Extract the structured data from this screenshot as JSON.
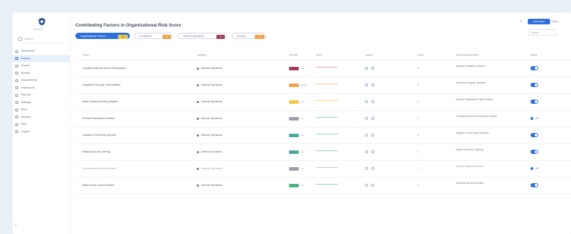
{
  "app": {
    "logo_text": "RISKAPP",
    "search_placeholder": "Search"
  },
  "sidebar": {
    "items": [
      {
        "label": "Dashboard",
        "active": false,
        "chevron": false
      },
      {
        "label": "Factors",
        "active": true,
        "chevron": false
      },
      {
        "label": "Scores",
        "active": false,
        "chevron": false
      },
      {
        "label": "Models",
        "active": false,
        "chevron": false
      },
      {
        "label": "Departments",
        "active": false,
        "chevron": false
      },
      {
        "label": "Employees",
        "active": false,
        "chevron": true
      },
      {
        "label": "Reports",
        "active": false,
        "chevron": false
      },
      {
        "label": "Settings",
        "active": false,
        "chevron": true
      },
      {
        "label": "More",
        "active": false,
        "chevron": true
      },
      {
        "label": "Security",
        "active": false,
        "chevron": false
      },
      {
        "label": "Help",
        "active": false,
        "chevron": true
      },
      {
        "label": "Logout",
        "active": false,
        "chevron": false
      }
    ]
  },
  "header": {
    "title": "Contributing Factors in Organizational Risk Score",
    "close": "×",
    "primary_button": "Add Factor",
    "secondary_button": "Export",
    "search_placeholder": "Search"
  },
  "tabs": [
    {
      "label": "Organizational Factors",
      "count": "12"
    },
    {
      "label": "Compliance",
      "count": "4"
    },
    {
      "label": "Internal Operations",
      "count": "3"
    },
    {
      "label": "Security",
      "count": "6"
    }
  ],
  "table": {
    "headers": [
      "Factor",
      "Category",
      "Severity",
      "Trend",
      "Actions",
      "Count",
      "Recommended Action",
      "Status"
    ],
    "rows": [
      {
        "factor": "Outdated Software Across Workspaces",
        "category": "Internal Operations",
        "severity_color": "#a33b5e",
        "severity_label": "High",
        "trend_color": "#f2a3b0",
        "count": "8",
        "rec": "Update Outdated Software",
        "enabled": true,
        "muted": false,
        "toggle_label": ""
      },
      {
        "factor": "Unpatched Security Vulnerabilities",
        "category": "Internal Operations",
        "severity_color": "#f0a24a",
        "severity_label": "Medium",
        "trend_color": "#f5c48a",
        "count": "5",
        "rec": "Schedule Regular Updates",
        "enabled": true,
        "muted": false,
        "toggle_label": ""
      },
      {
        "factor": "Weak Password Policy Adoption",
        "category": "Internal Operations",
        "severity_color": "#f2c94c",
        "severity_label": "Low",
        "trend_color": "#f5d97a",
        "count": "3",
        "rec": "Require Password Policy Review",
        "enabled": true,
        "muted": false,
        "toggle_label": ""
      },
      {
        "factor": "Excess Permissions Granted",
        "category": "Internal Operations",
        "severity_color": "#9a9fa8",
        "severity_label": "Low",
        "trend_color": "#8fd3c4",
        "count": "2",
        "rec": "Conduct Access Permissions Review",
        "enabled": false,
        "muted": false,
        "toggle_label": "Off"
      },
      {
        "factor": "Outdated Third-Party Libraries",
        "category": "Internal Operations",
        "severity_color": "#4aa79a",
        "severity_label": "Low",
        "trend_color": "#8fd3c4",
        "count": "2",
        "rec": "Upgrade Third-Party Libraries",
        "enabled": true,
        "muted": false,
        "toggle_label": ""
      },
      {
        "factor": "Missing Security Training",
        "category": "Internal Operations",
        "severity_color": "#4aa79a",
        "severity_label": "Low",
        "trend_color": "#8fd3c4",
        "count": "1",
        "rec": "Deliver Security Training",
        "enabled": true,
        "muted": false,
        "toggle_label": ""
      },
      {
        "factor": "Unmonitored Network Devices",
        "category": "Internal Operations",
        "severity_color": "#9a9fa8",
        "severity_label": "Low",
        "trend_color": "#c4cbd6",
        "count": "1",
        "rec": "Monitor Network Devices",
        "enabled": false,
        "muted": true,
        "toggle_label": "Off"
      },
      {
        "factor": "Stale Access Control Entries",
        "category": "Internal Operations",
        "severity_color": "#4caf7d",
        "severity_label": "Low",
        "trend_color": "#8fd3c4",
        "count": "1",
        "rec": "Schedule Access Review",
        "enabled": true,
        "muted": false,
        "toggle_label": ""
      }
    ]
  },
  "colors": {
    "accent": "#2e6fdb",
    "tab_count_1": "#f2c94c",
    "tab_count_2": "#f0a24a",
    "tab_count_3": "#a33b5e",
    "tab_count_4": "#f0a24a"
  }
}
